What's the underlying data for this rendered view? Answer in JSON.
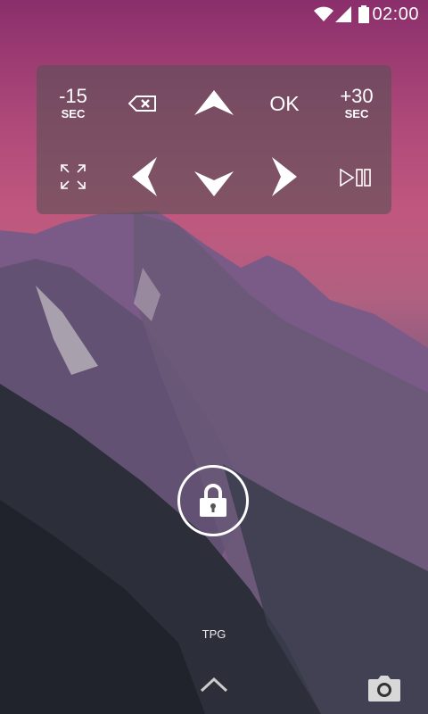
{
  "status_bar": {
    "time": "02:00",
    "icons": [
      "wifi-icon",
      "cell-signal-icon",
      "battery-icon"
    ]
  },
  "remote": {
    "rewind": {
      "value": "-15",
      "unit": "SEC"
    },
    "backspace": {
      "icon": "backspace-icon"
    },
    "up": {
      "icon": "arrow-up-icon"
    },
    "ok": {
      "label": "OK"
    },
    "forward": {
      "value": "+30",
      "unit": "SEC"
    },
    "fullscreen": {
      "icon": "fullscreen-icon"
    },
    "left": {
      "icon": "arrow-left-icon"
    },
    "down": {
      "icon": "arrow-down-icon"
    },
    "right": {
      "icon": "arrow-right-icon"
    },
    "play_pause": {
      "icon": "play-pause-icon"
    }
  },
  "lockscreen": {
    "lock_icon": "lock-icon",
    "owner_text": "TPG",
    "unlock_hint_icon": "chevron-up-icon",
    "camera_icon": "camera-icon"
  }
}
